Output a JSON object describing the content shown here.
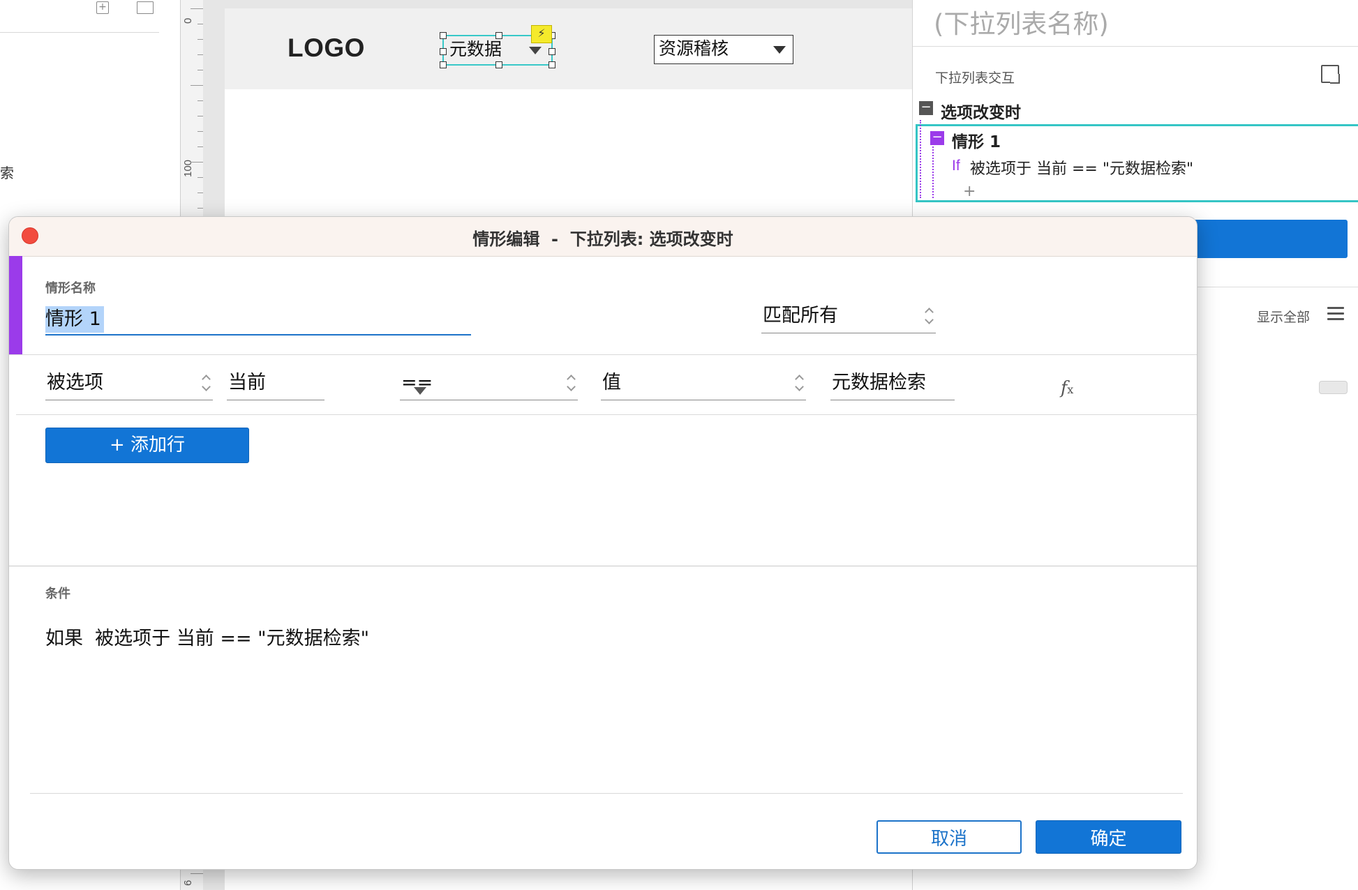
{
  "background": {
    "left_panel": {
      "cut_glyph": "索"
    },
    "ruler": {
      "labels": [
        "0",
        "100",
        "6"
      ]
    },
    "canvas": {
      "logo": "LOGO",
      "dropdown_selected": "元数据",
      "dropdown_other": "资源稽核"
    },
    "right_panel": {
      "widget_name": "(下拉列表名称)",
      "interactions_title": "下拉列表交互",
      "event_name": "选项改变时",
      "case_name": "情形 1",
      "case_if": "If",
      "case_condition": "被选项于 当前 == \"元数据检索\"",
      "add_symbol": "+",
      "show_all": "显示全部"
    }
  },
  "dialog": {
    "title": "情形编辑  -  下拉列表: 选项改变时",
    "case_name_label": "情形名称",
    "case_name_value": "情形 1",
    "match_mode": "匹配所有",
    "condition_row": {
      "target": "被选项",
      "scope": "当前",
      "operator": "==",
      "value_type": "值",
      "value": "元数据检索",
      "fx_icon": "fx-icon"
    },
    "add_row_label": "+ 添加行",
    "condition_label": "条件",
    "condition_summary": "如果  被选项于 当前 == \"元数据检索\"",
    "cancel_label": "取消",
    "ok_label": "确定"
  },
  "colors": {
    "accent_blue": "#1275d6",
    "case_purple": "#9b3bea",
    "selection_teal": "#35c5c5",
    "close_red": "#f24c3f"
  }
}
